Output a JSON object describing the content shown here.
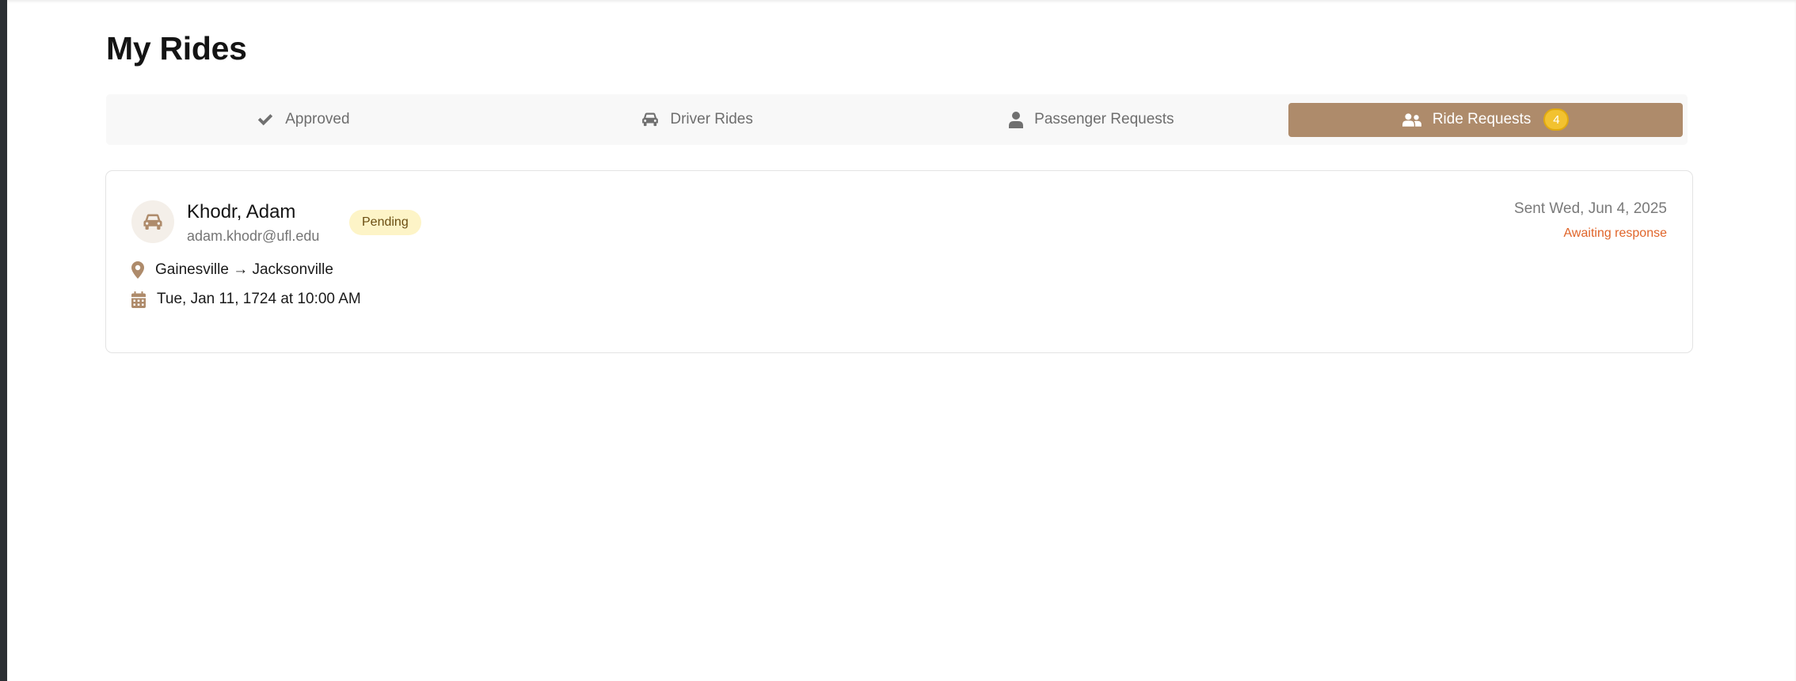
{
  "page": {
    "title": "My Rides"
  },
  "tabs": [
    {
      "label": "Approved",
      "icon": "check-icon"
    },
    {
      "label": "Driver Rides",
      "icon": "car-icon"
    },
    {
      "label": "Passenger Requests",
      "icon": "person-icon"
    },
    {
      "label": "Ride Requests",
      "icon": "users-icon",
      "badge": "4",
      "active": true
    }
  ],
  "request": {
    "name": "Khodr, Adam",
    "email": "adam.khodr@ufl.edu",
    "status": "Pending",
    "route": "Gainesville → Jacksonville",
    "datetime": "Tue, Jan 11, 1724 at 10:00 AM",
    "sent": "Sent Wed, Jun 4, 2025",
    "response_status": "Awaiting response",
    "avatar_icon": "car-icon"
  },
  "colors": {
    "accent": "#ae8b6b",
    "badge": "#f2c230",
    "pending_bg": "#fdf4c7",
    "awaiting": "#e0652a"
  }
}
